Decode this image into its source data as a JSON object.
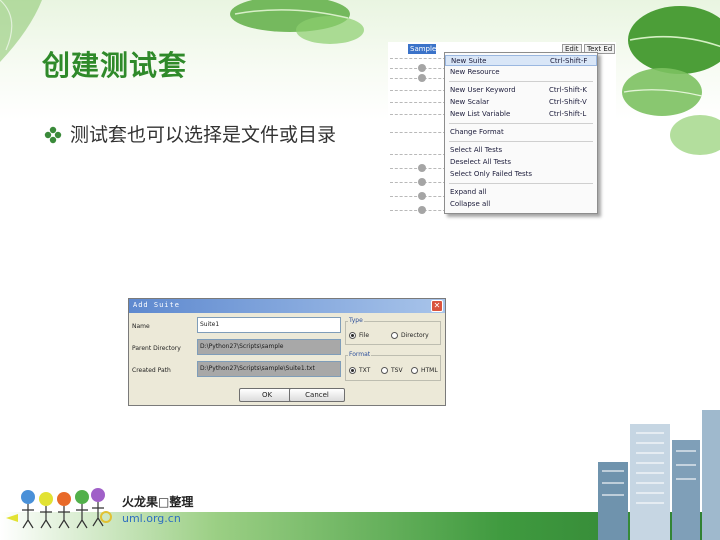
{
  "slide": {
    "title": "创建测试套",
    "bullet": "测试套也可以选择是文件或目录",
    "colors": {
      "title": "#2f8a2a",
      "bullet_icon": "#3a8a3a",
      "accent_green": "#4aa040"
    }
  },
  "menu_screenshot": {
    "tree_selected_label": "Sample",
    "header_buttons": [
      "Edit",
      "Text Ed"
    ],
    "items": [
      {
        "label": "New Suite",
        "shortcut": "Ctrl-Shift-F"
      },
      {
        "label": "New Resource",
        "shortcut": ""
      },
      {
        "label": "New User Keyword",
        "shortcut": "Ctrl-Shift-K"
      },
      {
        "label": "New Scalar",
        "shortcut": "Ctrl-Shift-V"
      },
      {
        "label": "New List Variable",
        "shortcut": "Ctrl-Shift-L"
      },
      {
        "label": "Change Format",
        "shortcut": ""
      },
      {
        "label": "Select All Tests",
        "shortcut": ""
      },
      {
        "label": "Deselect All Tests",
        "shortcut": ""
      },
      {
        "label": "Select Only Failed Tests",
        "shortcut": ""
      },
      {
        "label": "Expand all",
        "shortcut": ""
      },
      {
        "label": "Collapse all",
        "shortcut": ""
      }
    ]
  },
  "dialog": {
    "title": "Add Suite",
    "fields": {
      "name_label": "Name",
      "name_value": "Suite1",
      "parent_label": "Parent Directory",
      "parent_value": "D:\\Python27\\Scripts\\sample",
      "path_label": "Created Path",
      "path_value": "D:\\Python27\\Scripts\\sample\\Suite1.txt"
    },
    "type_group": {
      "label": "Type",
      "options": [
        "File",
        "Directory"
      ],
      "selected": "File"
    },
    "format_group": {
      "label": "Format",
      "options": [
        "TXT",
        "TSV",
        "HTML"
      ],
      "selected": "TXT"
    },
    "buttons": {
      "ok": "OK",
      "cancel": "Cancel"
    }
  },
  "footer": {
    "logo_name": "火龙果□整理",
    "logo_site": "uml.org.cn",
    "logo_colors": [
      "#4a90d8",
      "#e2e233",
      "#e86a2a",
      "#52b04a",
      "#a060c8"
    ]
  }
}
